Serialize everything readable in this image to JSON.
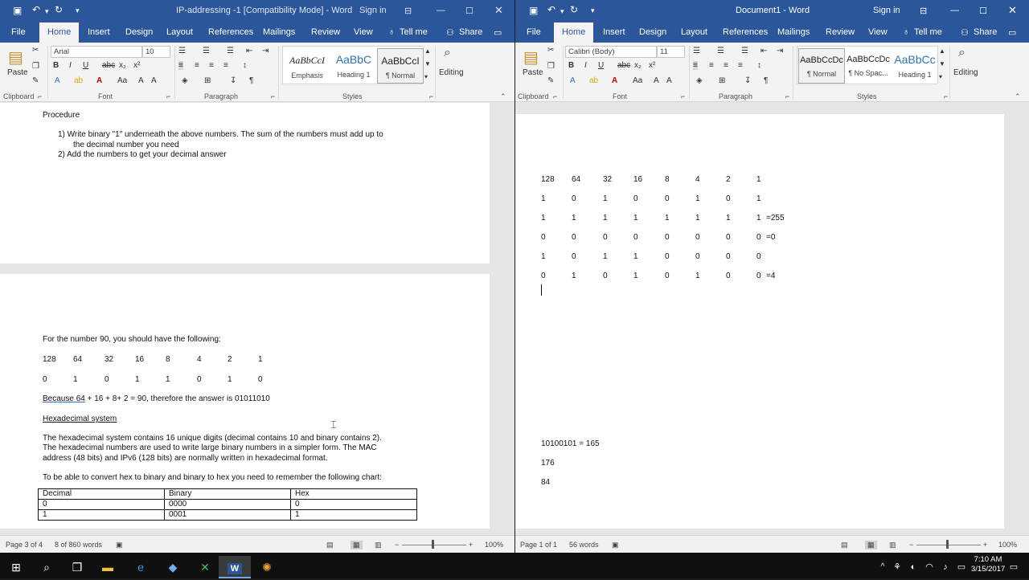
{
  "left": {
    "title": "IP-addressing -1 [Compatibility Mode]  -  Word",
    "signin": "Sign in",
    "tabs": [
      "File",
      "Home",
      "Insert",
      "Design",
      "Layout",
      "References",
      "Mailings",
      "Review",
      "View"
    ],
    "tellme": "Tell me",
    "share": "Share",
    "font": "Arial",
    "size": "10",
    "styles": [
      {
        "preview": "AaBbCcI",
        "name": "Emphasis"
      },
      {
        "preview": "AaBbC",
        "name": "Heading 1"
      },
      {
        "preview": "AaBbCcI",
        "name": "¶ Normal"
      }
    ],
    "groups": {
      "clipboard": "Clipboard",
      "font": "Font",
      "paragraph": "Paragraph",
      "styles": "Styles",
      "editing": "Editing",
      "paste": "Paste"
    },
    "doc": {
      "procedure": "Procedure",
      "step1a": "1)    Write binary \"1\" underneath the above numbers. The sum of the numbers must add up to",
      "step1b": "the decimal number you need",
      "step2": "2)    Add the numbers to get your decimal answer",
      "number90": "For the number 90, you should have the following:",
      "row1": [
        "128",
        "64",
        "32",
        "16",
        "8",
        "4",
        "2",
        "1"
      ],
      "row2": [
        "0",
        "1",
        "0",
        "1",
        "1",
        "0",
        "1",
        "0"
      ],
      "because_a": "Because  64",
      "because_b": " + 16 + 8+ 2 = 90, therefore the answer is 01011010",
      "hexheading": "Hexadecimal system",
      "hexpara1": "The hexadecimal system contains 16 unique digits (decimal contains 10 and binary contains 2).",
      "hexpara2": "The hexadecimal numbers are used to write large binary numbers in a simpler form. The MAC",
      "hexpara3": "address (48 bits) and IPv6 (128 bits) are normally written in hexadecimal format.",
      "convert": "To be able to convert hex to binary and binary to hex you need to remember the following chart:",
      "table_headers": [
        "Decimal",
        "Binary",
        "Hex"
      ],
      "table_rows": [
        [
          "0",
          "0000",
          "0"
        ],
        [
          "1",
          "0001",
          "1"
        ]
      ]
    },
    "status": {
      "page": "Page 3 of 4",
      "words": "8 of 860 words",
      "zoom": "100%"
    }
  },
  "right": {
    "title": "Document1  -  Word",
    "signin": "Sign in",
    "tabs": [
      "File",
      "Home",
      "Insert",
      "Design",
      "Layout",
      "References",
      "Mailings",
      "Review",
      "View"
    ],
    "tellme": "Tell me",
    "share": "Share",
    "font": "Calibri (Body)",
    "size": "11",
    "styles": [
      {
        "preview": "AaBbCcDc",
        "name": "¶ Normal"
      },
      {
        "preview": "AaBbCcDc",
        "name": "¶ No Spac..."
      },
      {
        "preview": "AaBbCc",
        "name": "Heading 1"
      }
    ],
    "groups": {
      "clipboard": "Clipboard",
      "font": "Font",
      "paragraph": "Paragraph",
      "styles": "Styles",
      "editing": "Editing",
      "paste": "Paste"
    },
    "doc": {
      "grid": [
        [
          "128",
          "64",
          "32",
          "16",
          "8",
          "4",
          "2",
          "1",
          ""
        ],
        [
          "1",
          "0",
          "1",
          "0",
          "0",
          "1",
          "0",
          "1",
          ""
        ],
        [
          "1",
          "1",
          "1",
          "1",
          "1",
          "1",
          "1",
          "1",
          "=255"
        ],
        [
          "0",
          "0",
          "0",
          "0",
          "0",
          "0",
          "0",
          "0",
          "=0"
        ],
        [
          "1",
          "0",
          "1",
          "1",
          "0",
          "0",
          "0",
          "0",
          ""
        ],
        [
          "0",
          "1",
          "0",
          "1",
          "0",
          "1",
          "0",
          "0",
          "=4"
        ]
      ],
      "conv1": "10100101 = 165",
      "conv2": "176",
      "conv3": "84"
    },
    "status": {
      "page": "Page 1 of 1",
      "words": "56 words",
      "zoom": "100%"
    }
  },
  "taskbar": {
    "time": "7:10 AM",
    "date": "3/15/2017"
  }
}
